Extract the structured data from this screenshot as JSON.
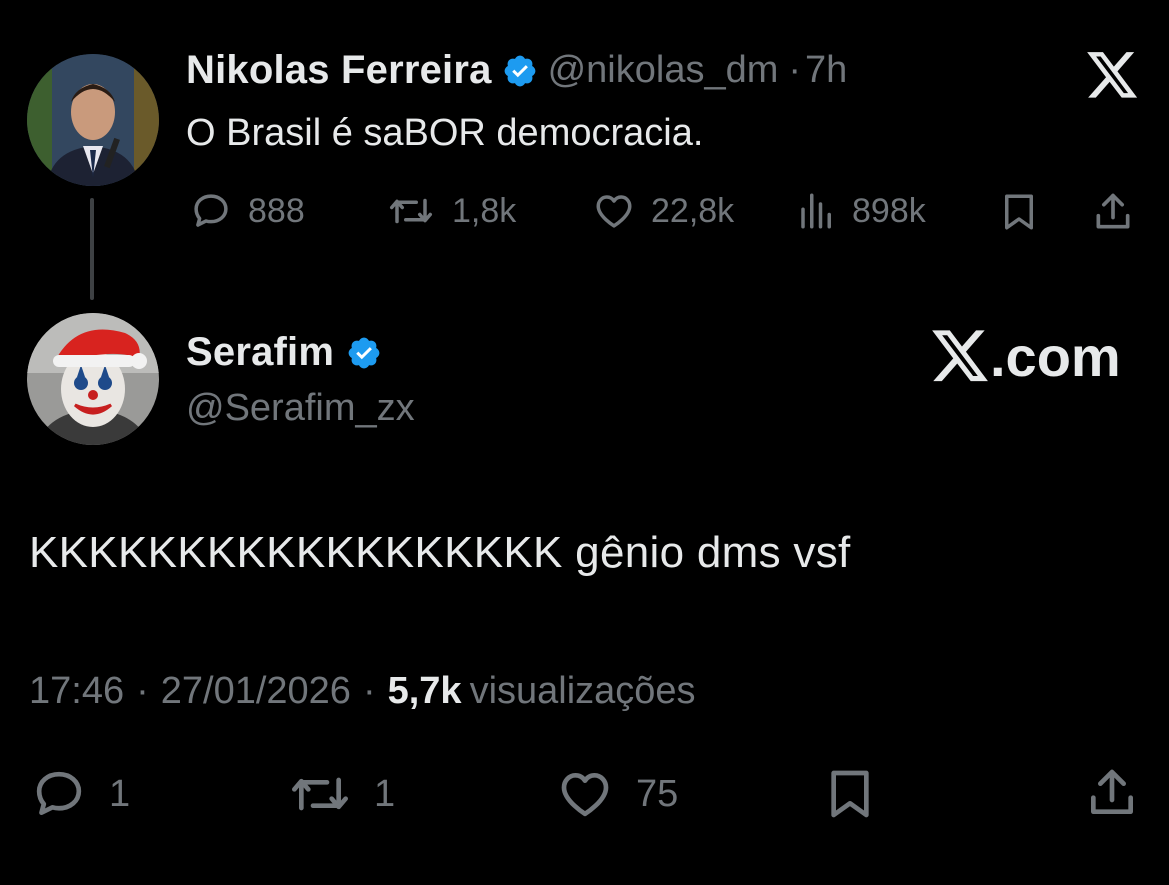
{
  "quoted_tweet": {
    "author_name": "Nikolas Ferreira",
    "author_handle": "@nikolas_dm",
    "separator": "·",
    "time_ago": "7h",
    "text": "O Brasil é saBOR democracia.",
    "stats": {
      "replies": "888",
      "reposts": "1,8k",
      "likes": "22,8k",
      "views": "898k"
    },
    "icons": [
      "reply-icon",
      "repost-icon",
      "like-icon",
      "views-icon",
      "bookmark-icon",
      "share-icon",
      "x-logo-icon"
    ]
  },
  "reply_tweet": {
    "author_name": "Serafim",
    "author_handle": "@Serafim_zx",
    "text": "KKKKKKKKKKKKKKKKKK gênio dms vsf",
    "time": "17:46",
    "date": "27/01/2026",
    "views_count": "5,7k",
    "views_label": "visualizações",
    "stats": {
      "replies": "1",
      "reposts": "1",
      "likes": "75"
    }
  },
  "watermark": {
    "text": ".com"
  },
  "colors": {
    "background": "#000000",
    "primary_text": "#e7e9ea",
    "secondary_text": "#71767b",
    "verified_blue": "#1d9bf0",
    "thread_line": "#3e4144"
  }
}
